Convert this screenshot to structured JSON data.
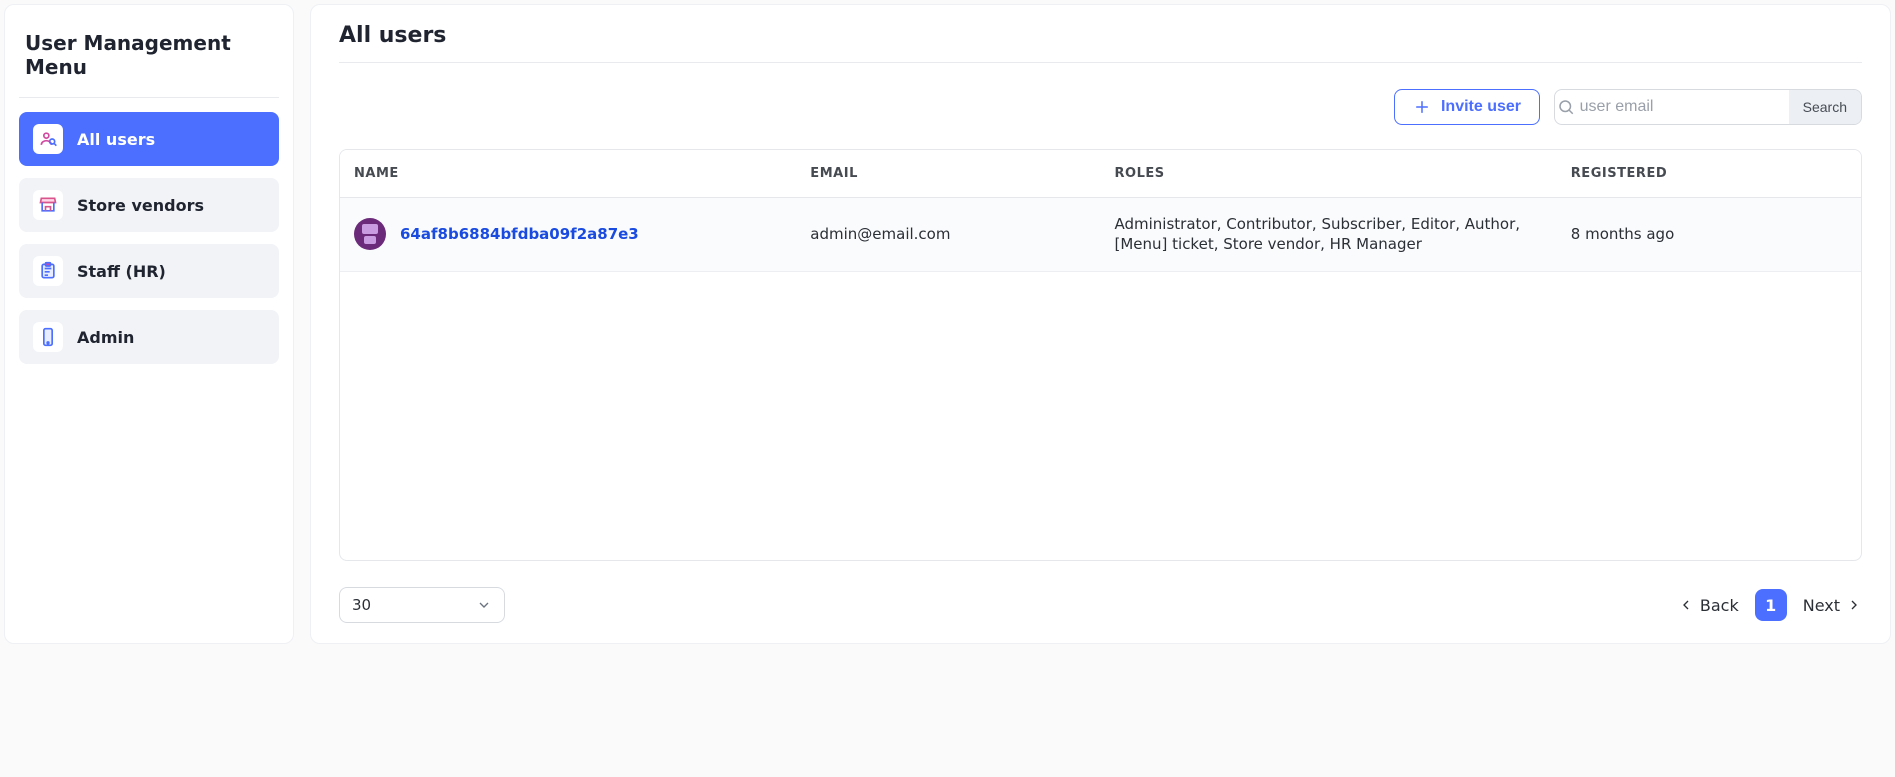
{
  "sidebar": {
    "title": "User Management Menu",
    "items": [
      {
        "label": "All users",
        "icon": "users-search-icon",
        "active": true
      },
      {
        "label": "Store vendors",
        "icon": "store-icon",
        "active": false
      },
      {
        "label": "Staff (HR)",
        "icon": "clipboard-icon",
        "active": false
      },
      {
        "label": "Admin",
        "icon": "phone-icon",
        "active": false
      }
    ]
  },
  "page": {
    "title": "All users"
  },
  "toolbar": {
    "invite_label": "Invite user",
    "search_placeholder": "user email",
    "search_button": "Search"
  },
  "table": {
    "columns": {
      "name": "NAME",
      "email": "EMAIL",
      "roles": "ROLES",
      "registered": "REGISTERED"
    },
    "rows": [
      {
        "name": "64af8b6884bfdba09f2a87e3",
        "email": "admin@email.com",
        "roles": "Administrator, Contributor, Subscriber, Editor, Author, [Menu] ticket, Store vendor, HR Manager",
        "registered": "8 months ago"
      }
    ]
  },
  "pagination": {
    "page_size": "30",
    "back_label": "Back",
    "next_label": "Next",
    "current_page": "1"
  }
}
